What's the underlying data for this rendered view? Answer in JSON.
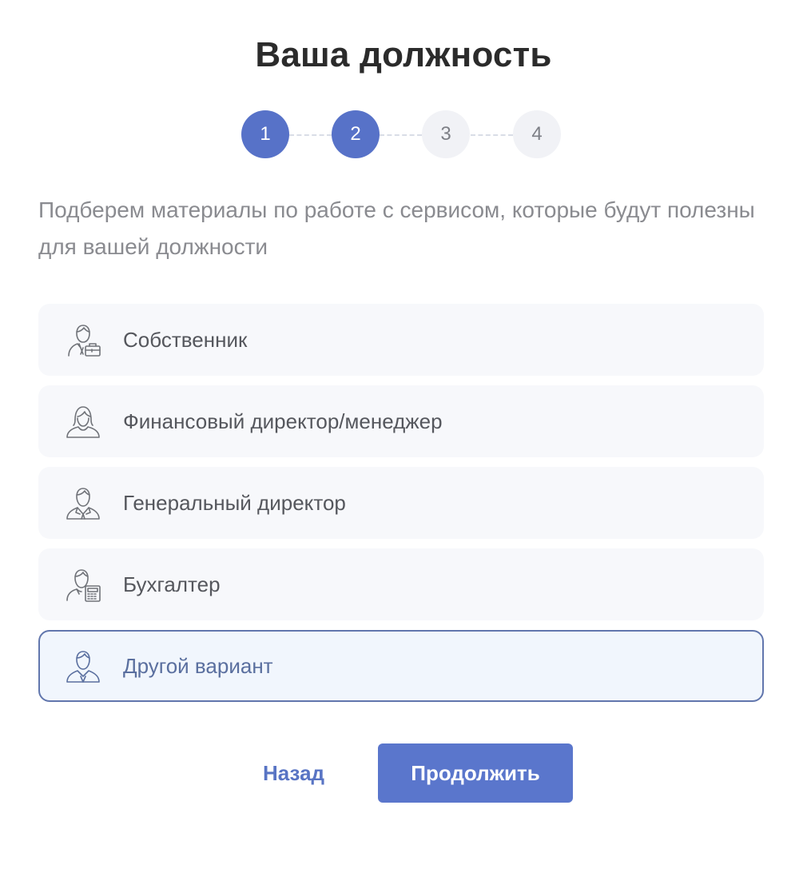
{
  "page": {
    "title": "Ваша должность",
    "subtitle": "Подберем материалы по работе с сервисом, которые будут полезны для вашей должности"
  },
  "stepper": {
    "steps": [
      {
        "label": "1",
        "state": "done"
      },
      {
        "label": "2",
        "state": "done"
      },
      {
        "label": "3",
        "state": "todo"
      },
      {
        "label": "4",
        "state": "todo"
      }
    ]
  },
  "options": [
    {
      "label": "Собственник",
      "icon": "owner-briefcase-icon",
      "selected": false
    },
    {
      "label": "Финансовый директор/менеджер",
      "icon": "female-person-icon",
      "selected": false
    },
    {
      "label": "Генеральный директор",
      "icon": "person-tie-icon",
      "selected": false
    },
    {
      "label": "Бухгалтер",
      "icon": "accountant-calculator-icon",
      "selected": false
    },
    {
      "label": "Другой вариант",
      "icon": "person-icon",
      "selected": true
    }
  ],
  "actions": {
    "back_label": "Назад",
    "next_label": "Продолжить"
  },
  "colors": {
    "accent": "#5A76CC",
    "selected_border": "#6176AD",
    "selected_bg": "#F1F6FD",
    "option_bg": "#F7F8FB",
    "step_inactive_bg": "#F1F2F6"
  }
}
